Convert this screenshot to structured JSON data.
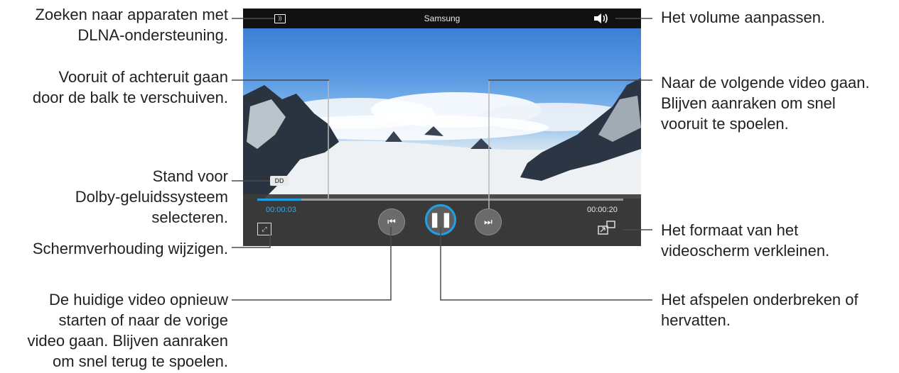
{
  "player": {
    "title": "Samsung",
    "current_time": "00:00:03",
    "total_time": "00:00:20",
    "progress_fraction": 0.12,
    "accent_color": "#1fa0e6",
    "icons": {
      "dlna": "dlna-icon",
      "volume": "volume-icon",
      "dolby": "dolby-icon",
      "aspect_ratio": "fullscreen-corners-icon",
      "previous": "skip-previous-icon",
      "pause": "pause-icon",
      "next": "skip-next-icon",
      "popup": "popup-window-icon"
    }
  },
  "annotations": {
    "dlna": "Zoeken naar apparaten met\nDLNA-ondersteuning.",
    "seek": "Vooruit of achteruit gaan\ndoor de balk te verschuiven.",
    "dolby": "Stand voor\nDolby-geluidssysteem\nselecteren.",
    "aspect": "Schermverhouding wijzigen.",
    "previous": "De huidige video opnieuw\nstarten of naar de vorige\nvideo gaan. Blijven aanraken\nom snel terug te spoelen.",
    "volume": "Het volume aanpassen.",
    "next": "Naar de volgende video gaan.\nBlijven aanraken om snel\nvooruit te spoelen.",
    "popup": "Het formaat van het\nvideoscherm verkleinen.",
    "pause": "Het afspelen onderbreken of\nhervatten."
  }
}
